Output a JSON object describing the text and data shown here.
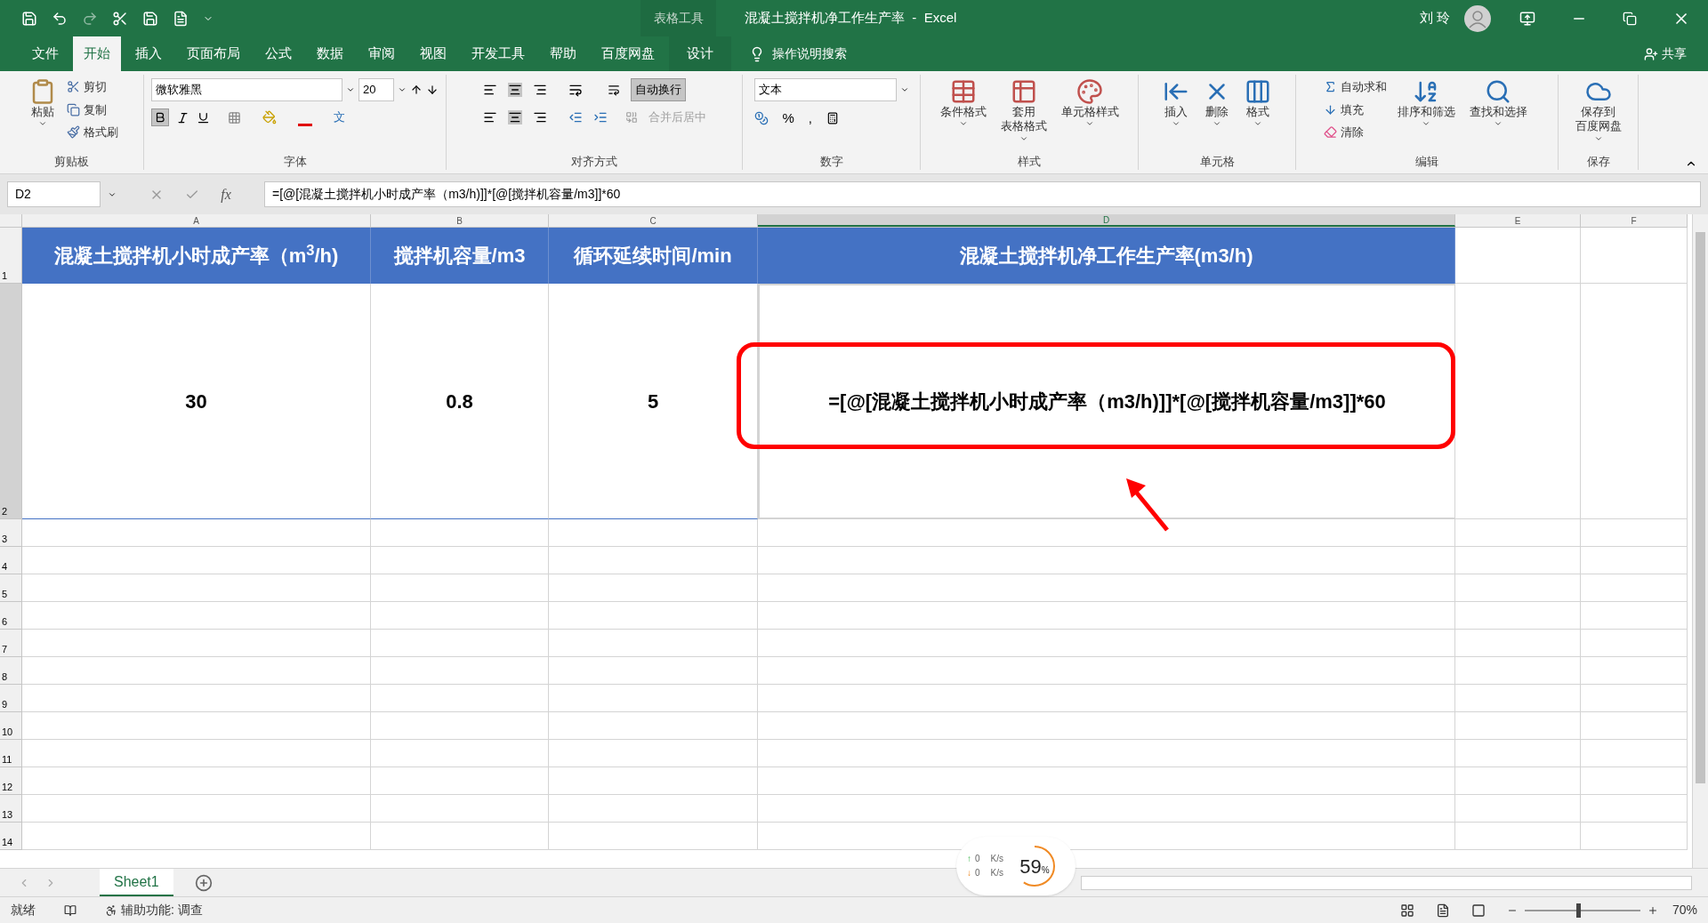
{
  "title_bar": {
    "context_label": "表格工具",
    "title": "混凝土搅拌机净工作生产率  -  Excel",
    "user": "刘 玲"
  },
  "menu_tabs": [
    {
      "label": "文件",
      "selected": false,
      "kind": "normal"
    },
    {
      "label": "开始",
      "selected": true,
      "kind": "normal"
    },
    {
      "label": "插入",
      "selected": false,
      "kind": "normal"
    },
    {
      "label": "页面布局",
      "selected": false,
      "kind": "normal"
    },
    {
      "label": "公式",
      "selected": false,
      "kind": "normal"
    },
    {
      "label": "数据",
      "selected": false,
      "kind": "normal"
    },
    {
      "label": "审阅",
      "selected": false,
      "kind": "normal"
    },
    {
      "label": "视图",
      "selected": false,
      "kind": "normal"
    },
    {
      "label": "开发工具",
      "selected": false,
      "kind": "normal"
    },
    {
      "label": "帮助",
      "selected": false,
      "kind": "normal"
    },
    {
      "label": "百度网盘",
      "selected": false,
      "kind": "normal"
    },
    {
      "label": "设计",
      "selected": false,
      "kind": "contextual"
    }
  ],
  "tell_me": "操作说明搜索",
  "share": "共享",
  "ribbon": {
    "clipboard": {
      "paste": "粘贴",
      "items": [
        "剪切",
        "复制",
        "格式刷"
      ],
      "label": "剪贴板"
    },
    "font": {
      "name": "微软雅黑",
      "size": "20",
      "bold": true,
      "label": "字体",
      "phonetic": "文"
    },
    "alignment": {
      "wrap": {
        "label": "自动换行",
        "selected": true
      },
      "merge": {
        "label": "合并后居中",
        "disabled": true
      },
      "label": "对齐方式"
    },
    "number": {
      "format": "文本",
      "percent": "%",
      "comma": ",",
      "label": "数字"
    },
    "styles": {
      "items": [
        [
          "条件格式"
        ],
        [
          "套用",
          "表格格式"
        ],
        [
          "单元格样式"
        ]
      ],
      "label": "样式"
    },
    "cells": {
      "items": [
        "插入",
        "删除",
        "格式"
      ],
      "label": "单元格"
    },
    "editing": {
      "items": [
        "自动求和",
        "填充",
        "清除"
      ],
      "big": [
        "排序和筛选",
        "查找和选择"
      ],
      "label": "编辑"
    },
    "save": {
      "item": [
        "保存到",
        "百度网盘"
      ],
      "label": "保存"
    }
  },
  "formula_bar": {
    "name_box": "D2",
    "fx": "fx",
    "formula": "=[@[混凝土搅拌机小时成产率（m3/h)]]*[@[搅拌机容量/m3]]*60"
  },
  "columns": [
    {
      "label": "A",
      "selected": false
    },
    {
      "label": "B",
      "selected": false
    },
    {
      "label": "C",
      "selected": false
    },
    {
      "label": "D",
      "selected": true
    },
    {
      "label": "E",
      "selected": false
    },
    {
      "label": "F",
      "selected": false
    }
  ],
  "rows": [
    "1",
    "2",
    "3",
    "4",
    "5",
    "6",
    "7",
    "8",
    "9",
    "10",
    "11",
    "12",
    "13",
    "14"
  ],
  "table": {
    "header": [
      "混凝土搅拌机小时成产率（m$^{3}$/h)",
      "搅拌机容量/m3",
      "循环延续时间/min",
      "混凝土搅拌机净工作生产率(m3/h)"
    ],
    "row": [
      "30",
      "0.8",
      "5",
      "=[@[混凝土搅拌机小时成产率（m3/h)]]*[@[搅拌机容量/m3]]*60"
    ]
  },
  "sheet_tabs": [
    {
      "label": "Sheet1",
      "selected": true
    }
  ],
  "status_bar": {
    "ready": "就绪",
    "accessibility": "辅助功能: 调查",
    "zoom": "70%",
    "zoom_slider": {
      "level": 0.45
    }
  },
  "speed_widget": {
    "up_arrow": "↑",
    "up": "0",
    "up_unit": "K/s",
    "down_arrow": "↓",
    "down": "0",
    "down_unit": "K/s",
    "percent": "59",
    "percent_sign": "%"
  }
}
